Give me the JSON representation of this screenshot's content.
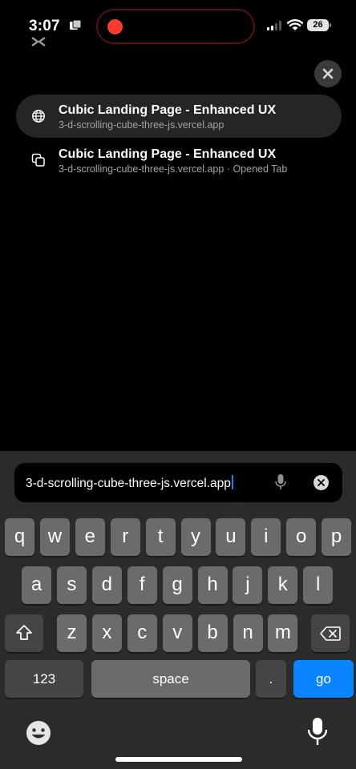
{
  "status": {
    "time": "3:07",
    "battery": "26"
  },
  "suggestions": [
    {
      "title": "Cubic Landing Page - Enhanced UX",
      "subtitle": "3-d-scrolling-cube-three-js.vercel.app",
      "icon": "globe-icon"
    },
    {
      "title": "Cubic Landing Page - Enhanced UX",
      "subtitle": "3-d-scrolling-cube-three-js.vercel.app · Opened Tab",
      "icon": "tabs-icon"
    }
  ],
  "address_bar": {
    "value": "3-d-scrolling-cube-three-js.vercel.app"
  },
  "keyboard": {
    "row1": [
      "q",
      "w",
      "e",
      "r",
      "t",
      "y",
      "u",
      "i",
      "o",
      "p"
    ],
    "row2": [
      "a",
      "s",
      "d",
      "f",
      "g",
      "h",
      "j",
      "k",
      "l"
    ],
    "row3": [
      "z",
      "x",
      "c",
      "v",
      "b",
      "n",
      "m"
    ],
    "numbers_label": "123",
    "space_label": "space",
    "period_label": ".",
    "go_label": "go"
  },
  "colors": {
    "accent": "#0a84ff",
    "record": "#ff3b30",
    "key": "#6b6b6d",
    "key_dark": "#454547"
  }
}
